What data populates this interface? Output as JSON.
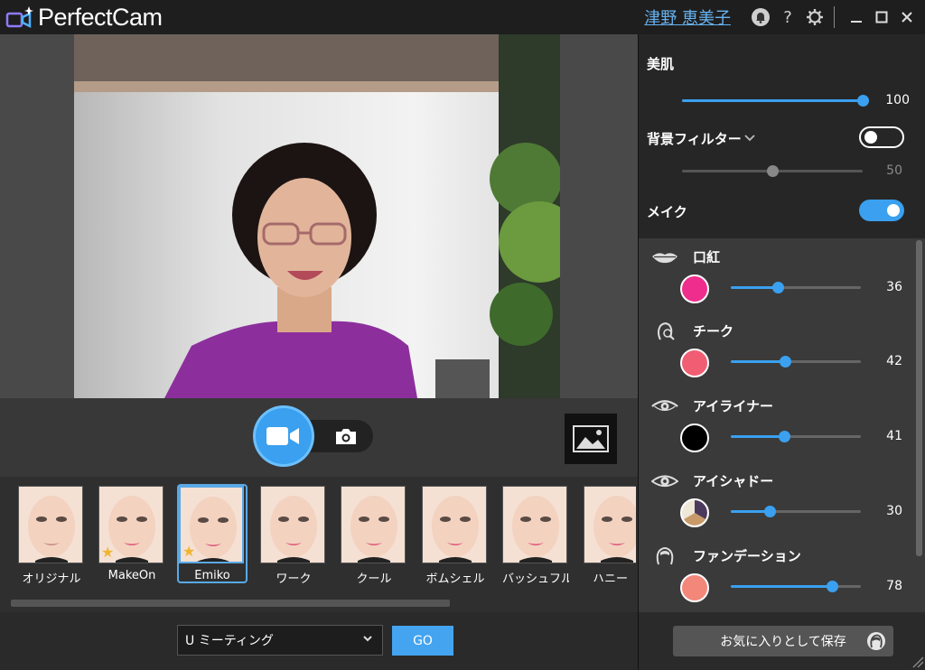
{
  "app": {
    "title": "PerfectCam"
  },
  "titlebar": {
    "username": "津野 恵美子",
    "help": "?"
  },
  "controls": {
    "mode": "video"
  },
  "presets": [
    {
      "label": "オリジナル",
      "starred": false
    },
    {
      "label": "MakeOn",
      "starred": true
    },
    {
      "label": "Emiko",
      "starred": true,
      "selected": true
    },
    {
      "label": "ワーク",
      "starred": false
    },
    {
      "label": "クール",
      "starred": false
    },
    {
      "label": "ボムシェル",
      "starred": false
    },
    {
      "label": "バッシュフル",
      "starred": false
    },
    {
      "label": "ハニー",
      "starred": false
    }
  ],
  "footer": {
    "meeting_select": "U ミーティング",
    "go_label": "GO",
    "favorite_label": "お気に入りとして保存"
  },
  "panel": {
    "skin": {
      "label": "美肌",
      "value": 100
    },
    "background_filter": {
      "label": "背景フィルター",
      "value": 50,
      "enabled": false
    },
    "makeup": {
      "label": "メイク",
      "enabled": true
    }
  },
  "makeup_items": [
    {
      "label": "口紅",
      "value": 36,
      "color": "#ef2d8c",
      "icon": "lips-icon"
    },
    {
      "label": "チーク",
      "value": 42,
      "color": "#f15d73",
      "icon": "blush-icon"
    },
    {
      "label": "アイライナー",
      "value": 41,
      "color": "#000000",
      "icon": "eye-icon"
    },
    {
      "label": "アイシャドー",
      "value": 30,
      "color": "palette",
      "icon": "eye-icon"
    },
    {
      "label": "ファンデーション",
      "value": 78,
      "color": "#f2877a",
      "icon": "face-icon"
    }
  ],
  "colors": {
    "accent": "#3aa0ef",
    "link": "#66b3f2"
  }
}
